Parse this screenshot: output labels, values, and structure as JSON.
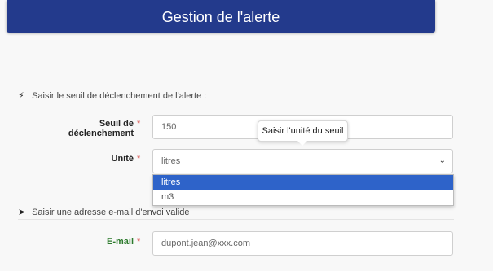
{
  "header": {
    "title": "Gestion de l'alerte"
  },
  "section_threshold": {
    "icon": "bolt-icon",
    "title": "Saisir le seuil de déclenchement de l'alerte :"
  },
  "threshold_field": {
    "label": "Seuil de déclenchement",
    "required_mark": "*",
    "value": "150"
  },
  "unit_field": {
    "label": "Unité",
    "required_mark": "*",
    "selected": "litres",
    "tooltip": "Saisir l'unité du seuil",
    "options": [
      "litres",
      "m3"
    ]
  },
  "section_email": {
    "icon": "paper-plane-icon",
    "title": "Saisir une adresse e-mail d'envoi valide"
  },
  "email_field": {
    "label": "E-mail",
    "required_mark": "*",
    "placeholder": "dupont.jean@xxx.com"
  },
  "colors": {
    "header_bg": "#233a8c",
    "selected_option": "#2e63c9",
    "required": "#d9534f",
    "email_label": "#2c7a2c"
  }
}
